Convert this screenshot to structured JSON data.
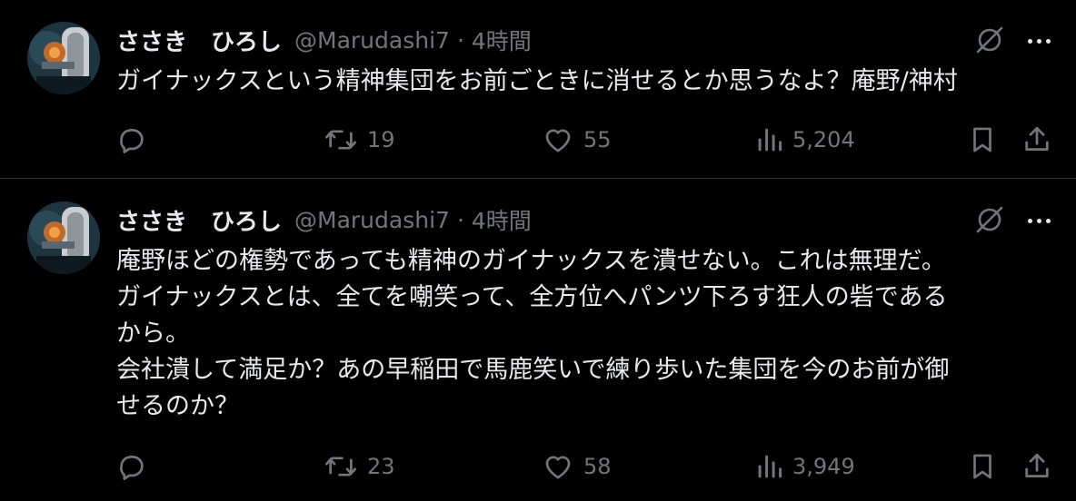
{
  "tweets": [
    {
      "name": "ささき　ひろし",
      "handle": "@Marudashi7",
      "separator": "·",
      "time": "4時間",
      "lines": [
        "ガイナックスという精神集団をお前ごときに消せるとか思うなよ？庵野/神村"
      ],
      "replies": "",
      "retweets": "19",
      "likes": "55",
      "views": "5,204"
    },
    {
      "name": "ささき　ひろし",
      "handle": "@Marudashi7",
      "separator": "·",
      "time": "4時間",
      "lines": [
        "庵野ほどの権勢であっても精神のガイナックスを潰せない。これは無理だ。",
        "ガイナックスとは、全てを嘲笑って、全方位へパンツ下ろす狂人の砦である",
        "から。",
        "会社潰して満足か？あの早稲田で馬鹿笑いで練り歩いた集団を今のお前が御",
        "せるのか？"
      ],
      "replies": "",
      "retweets": "23",
      "likes": "58",
      "views": "3,949"
    }
  ],
  "icons": {
    "avatar": "robot-avatar",
    "grok": "grok-icon",
    "more": "more-icon",
    "reply": "reply-icon",
    "retweet": "retweet-icon",
    "like": "heart-icon",
    "views": "views-icon",
    "bookmark": "bookmark-icon",
    "share": "share-icon"
  },
  "colors": {
    "background": "#000000",
    "text": "#e7e9ea",
    "secondary": "#71767b",
    "divider": "#2f3336"
  }
}
